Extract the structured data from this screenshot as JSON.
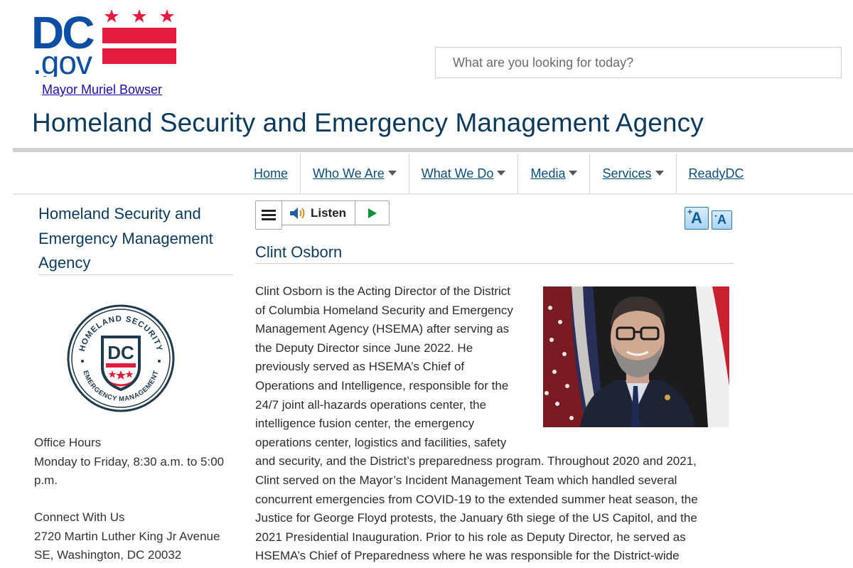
{
  "header": {
    "logo_text_top": "DC",
    "logo_text_bottom": ".gov",
    "mayor_link": "Mayor Muriel Bowser",
    "search_placeholder": "What are you looking for today?",
    "agency_title": "Homeland Security and Emergency Management Agency"
  },
  "nav": {
    "items": [
      {
        "label": "Home",
        "has_dropdown": false
      },
      {
        "label": "Who We Are",
        "has_dropdown": true
      },
      {
        "label": "What We Do",
        "has_dropdown": true
      },
      {
        "label": "Media",
        "has_dropdown": true
      },
      {
        "label": "Services",
        "has_dropdown": true
      },
      {
        "label": "ReadyDC",
        "has_dropdown": false
      }
    ]
  },
  "sidebar": {
    "title": "Homeland Security and Emergency Management Agency",
    "seal": {
      "text_top": "HOMELAND SECURITY",
      "text_bottom": "EMERGENCY MANAGEMENT",
      "center": "DC"
    },
    "office_hours_heading": "Office Hours",
    "office_hours_text": "Monday to Friday, 8:30 a.m. to 5:00 p.m.",
    "connect_heading": "Connect With Us",
    "connect_address": "2720 Martin Luther King Jr Avenue SE, Washington, DC 20032"
  },
  "toolbar": {
    "listen_label": "Listen",
    "font_increase": "A",
    "font_decrease": "A",
    "font_increase_mod": "+",
    "font_decrease_mod": "-"
  },
  "content": {
    "title": "Clint Osborn",
    "bio_narrow": [
      "Clint Osborn is the Acting Director of the District",
      "of Columbia Homeland Security and Emergency",
      "Management Agency (HSEMA) after serving as",
      "the Deputy Director since June 2022. He",
      "previously served as HSEMA’s Chief of",
      "Operations and Intelligence, responsible for the",
      "24/7 joint all-hazards operations center, the",
      "intelligence fusion center, the emergency",
      "operations center, logistics and facilities, safety"
    ],
    "bio_wide": [
      "and security, and the District’s preparedness program. Throughout 2020 and 2021,",
      "Clint served on the Mayor’s Incident Management Team which handled several",
      "concurrent emergencies from COVID-19 to the extended summer heat season, the",
      "Justice for George Floyd protests, the January 6th siege of the US Capitol, and the",
      "2021 Presidential Inauguration. Prior to his role as Deputy Director, he served as",
      "HSEMA’s Chief of Preparedness where he was responsible for the District-wide"
    ]
  },
  "colors": {
    "dc_blue": "#0b4ea2",
    "dc_red": "#e31c3d",
    "title_navy": "#0b3b5c",
    "link_blue": "#1a0dab"
  }
}
